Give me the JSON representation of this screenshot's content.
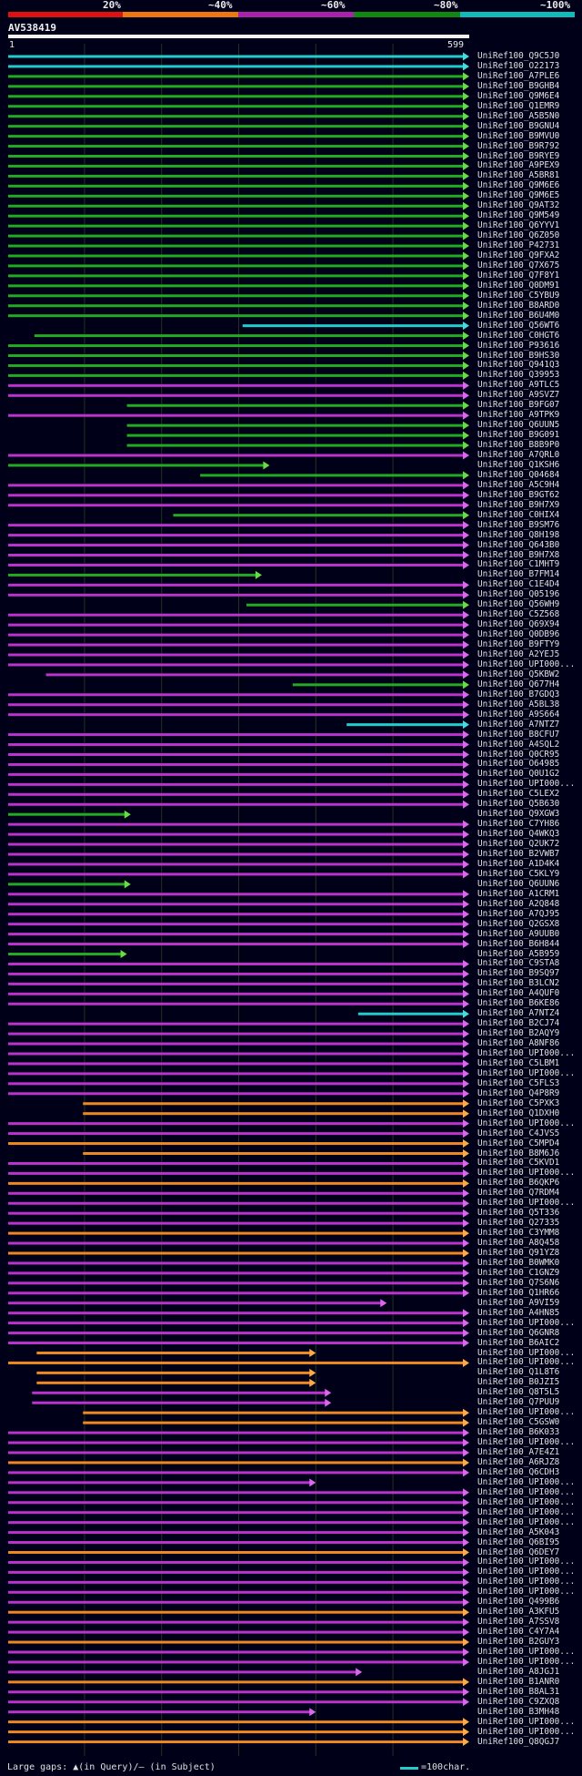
{
  "legend": {
    "labels": [
      "20%",
      "~40%",
      "~60%",
      "~80%",
      "~100%"
    ],
    "colors": [
      "#dd1111",
      "#ee7711",
      "#aa22aa",
      "#118811",
      "#11bbbb"
    ]
  },
  "query": {
    "name": "AV538419",
    "start": "1",
    "end": "599"
  },
  "footer": {
    "gaps_text": "Large gaps: ▲(in Query)/– (in Subject)",
    "scale_text": "=100char."
  },
  "chart_data": {
    "type": "alignment-overview",
    "query_length": 599,
    "color_by_identity": {
      "20%": "#dd1111",
      "~40%": "#ee7711",
      "~60%": "#aa22aa",
      "~80%": "#118811",
      "~100%": "#11bbbb"
    },
    "hits": [
      {
        "name": "UniRef100_Q9C5J0",
        "c": "t",
        "s": 1,
        "e": 599
      },
      {
        "name": "UniRef100_O22173",
        "c": "t",
        "s": 1,
        "e": 599
      },
      {
        "name": "UniRef100_A7PLE6",
        "c": "g",
        "s": 1,
        "e": 599
      },
      {
        "name": "UniRef100_B9GHB4",
        "c": "g",
        "s": 1,
        "e": 599
      },
      {
        "name": "UniRef100_Q9M6E4",
        "c": "g",
        "s": 1,
        "e": 599
      },
      {
        "name": "UniRef100_Q1EMR9",
        "c": "g",
        "s": 1,
        "e": 599
      },
      {
        "name": "UniRef100_A5B5N0",
        "c": "g",
        "s": 1,
        "e": 599
      },
      {
        "name": "UniRef100_B9GNU4",
        "c": "g",
        "s": 1,
        "e": 599
      },
      {
        "name": "UniRef100_B9MVU0",
        "c": "g",
        "s": 1,
        "e": 599
      },
      {
        "name": "UniRef100_B9R792",
        "c": "g",
        "s": 1,
        "e": 599
      },
      {
        "name": "UniRef100_B9RYE9",
        "c": "g",
        "s": 1,
        "e": 599
      },
      {
        "name": "UniRef100_A9PEX9",
        "c": "g",
        "s": 1,
        "e": 599
      },
      {
        "name": "UniRef100_A5BR81",
        "c": "g",
        "s": 1,
        "e": 599
      },
      {
        "name": "UniRef100_Q9M6E6",
        "c": "g",
        "s": 1,
        "e": 599
      },
      {
        "name": "UniRef100_Q9M6E5",
        "c": "g",
        "s": 1,
        "e": 599
      },
      {
        "name": "UniRef100_Q9AT32",
        "c": "g",
        "s": 1,
        "e": 599
      },
      {
        "name": "UniRef100_Q9M549",
        "c": "g",
        "s": 1,
        "e": 599
      },
      {
        "name": "UniRef100_Q6YYV1",
        "c": "g",
        "s": 1,
        "e": 599
      },
      {
        "name": "UniRef100_Q6Z050",
        "c": "g",
        "s": 1,
        "e": 599
      },
      {
        "name": "UniRef100_P42731",
        "c": "g",
        "s": 1,
        "e": 599
      },
      {
        "name": "UniRef100_Q9FXA2",
        "c": "g",
        "s": 1,
        "e": 599
      },
      {
        "name": "UniRef100_Q7X675",
        "c": "g",
        "s": 1,
        "e": 599
      },
      {
        "name": "UniRef100_Q7F8Y1",
        "c": "g",
        "s": 1,
        "e": 599
      },
      {
        "name": "UniRef100_Q0DM91",
        "c": "g",
        "s": 1,
        "e": 599
      },
      {
        "name": "UniRef100_C5YBU9",
        "c": "g",
        "s": 1,
        "e": 599
      },
      {
        "name": "UniRef100_B8ARD0",
        "c": "g",
        "s": 1,
        "e": 599
      },
      {
        "name": "UniRef100_B6U4M0",
        "c": "g",
        "s": 1,
        "e": 599
      },
      {
        "name": "UniRef100_Q56WT6",
        "c": "t",
        "s": 305,
        "e": 599
      },
      {
        "name": "UniRef100_C0HGT6",
        "c": "g",
        "s": 35,
        "e": 599
      },
      {
        "name": "UniRef100_P93616",
        "c": "g",
        "s": 1,
        "e": 599
      },
      {
        "name": "UniRef100_B9HS30",
        "c": "g",
        "s": 1,
        "e": 599
      },
      {
        "name": "UniRef100_Q941Q3",
        "c": "g",
        "s": 1,
        "e": 599
      },
      {
        "name": "UniRef100_Q39953",
        "c": "g",
        "s": 1,
        "e": 599
      },
      {
        "name": "UniRef100_A9TLC5",
        "c": "p",
        "s": 1,
        "e": 599
      },
      {
        "name": "UniRef100_A9SVZ7",
        "c": "p",
        "s": 1,
        "e": 599
      },
      {
        "name": "UniRef100_B9FG07",
        "c": "g",
        "s": 155,
        "e": 599
      },
      {
        "name": "UniRef100_A9TPK9",
        "c": "p",
        "s": 1,
        "e": 599
      },
      {
        "name": "UniRef100_Q6UUN5",
        "c": "g",
        "s": 155,
        "e": 599
      },
      {
        "name": "UniRef100_B9G091",
        "c": "g",
        "s": 155,
        "e": 599
      },
      {
        "name": "UniRef100_B8B9P0",
        "c": "g",
        "s": 155,
        "e": 599
      },
      {
        "name": "UniRef100_A7QRL0",
        "c": "p",
        "s": 1,
        "e": 599
      },
      {
        "name": "UniRef100_Q1KSH6",
        "c": "g",
        "s": 1,
        "e": 340
      },
      {
        "name": "UniRef100_Q04684",
        "c": "g",
        "s": 250,
        "e": 599
      },
      {
        "name": "UniRef100_A5C9H4",
        "c": "p",
        "s": 1,
        "e": 599
      },
      {
        "name": "UniRef100_B9GT62",
        "c": "p",
        "s": 1,
        "e": 599
      },
      {
        "name": "UniRef100_B9H7X9",
        "c": "p",
        "s": 1,
        "e": 599
      },
      {
        "name": "UniRef100_C0HIX4",
        "c": "g",
        "s": 215,
        "e": 599
      },
      {
        "name": "UniRef100_B9SM76",
        "c": "p",
        "s": 1,
        "e": 599
      },
      {
        "name": "UniRef100_Q8H198",
        "c": "p",
        "s": 1,
        "e": 599
      },
      {
        "name": "UniRef100_Q643B0",
        "c": "p",
        "s": 1,
        "e": 599
      },
      {
        "name": "UniRef100_B9H7X8",
        "c": "p",
        "s": 1,
        "e": 599
      },
      {
        "name": "UniRef100_C1MHT9",
        "c": "p",
        "s": 1,
        "e": 599
      },
      {
        "name": "UniRef100_B7FM14",
        "c": "g",
        "s": 1,
        "e": 330
      },
      {
        "name": "UniRef100_C1E4D4",
        "c": "p",
        "s": 1,
        "e": 599
      },
      {
        "name": "UniRef100_Q05196",
        "c": "p",
        "s": 1,
        "e": 599
      },
      {
        "name": "UniRef100_Q56WH9",
        "c": "g",
        "s": 310,
        "e": 599
      },
      {
        "name": "UniRef100_C5Z568",
        "c": "p",
        "s": 1,
        "e": 599
      },
      {
        "name": "UniRef100_Q69X94",
        "c": "p",
        "s": 1,
        "e": 599
      },
      {
        "name": "UniRef100_Q0DB96",
        "c": "p",
        "s": 1,
        "e": 599
      },
      {
        "name": "UniRef100_B9FTY9",
        "c": "p",
        "s": 1,
        "e": 599
      },
      {
        "name": "UniRef100_A2YEJ5",
        "c": "p",
        "s": 1,
        "e": 599
      },
      {
        "name": "UniRef100_UPI000...",
        "c": "p",
        "s": 1,
        "e": 599
      },
      {
        "name": "UniRef100_Q5KBW2",
        "c": "p",
        "s": 50,
        "e": 599
      },
      {
        "name": "UniRef100_Q677H4",
        "c": "g",
        "s": 370,
        "e": 599
      },
      {
        "name": "UniRef100_B7GDQ3",
        "c": "p",
        "s": 1,
        "e": 599
      },
      {
        "name": "UniRef100_A5BL38",
        "c": "p",
        "s": 1,
        "e": 599
      },
      {
        "name": "UniRef100_A9S664",
        "c": "p",
        "s": 1,
        "e": 599
      },
      {
        "name": "UniRef100_A7NTZ7",
        "c": "t",
        "s": 440,
        "e": 599
      },
      {
        "name": "UniRef100_B8CFU7",
        "c": "p",
        "s": 1,
        "e": 599
      },
      {
        "name": "UniRef100_A4SQL2",
        "c": "p",
        "s": 1,
        "e": 599
      },
      {
        "name": "UniRef100_Q0CR95",
        "c": "p",
        "s": 1,
        "e": 599
      },
      {
        "name": "UniRef100_O64985",
        "c": "p",
        "s": 1,
        "e": 599
      },
      {
        "name": "UniRef100_Q0U1G2",
        "c": "p",
        "s": 1,
        "e": 599
      },
      {
        "name": "UniRef100_UPI000...",
        "c": "p",
        "s": 1,
        "e": 599
      },
      {
        "name": "UniRef100_C5LEX2",
        "c": "p",
        "s": 1,
        "e": 599
      },
      {
        "name": "UniRef100_Q5B630",
        "c": "p",
        "s": 1,
        "e": 599
      },
      {
        "name": "UniRef100_Q9XGW3",
        "c": "g",
        "s": 1,
        "e": 160
      },
      {
        "name": "UniRef100_C7YH86",
        "c": "p",
        "s": 1,
        "e": 599
      },
      {
        "name": "UniRef100_Q4WKQ3",
        "c": "p",
        "s": 1,
        "e": 599
      },
      {
        "name": "UniRef100_Q2UK72",
        "c": "p",
        "s": 1,
        "e": 599
      },
      {
        "name": "UniRef100_B2VWB7",
        "c": "p",
        "s": 1,
        "e": 599
      },
      {
        "name": "UniRef100_A1D4K4",
        "c": "p",
        "s": 1,
        "e": 599
      },
      {
        "name": "UniRef100_C5KLY9",
        "c": "p",
        "s": 1,
        "e": 599
      },
      {
        "name": "UniRef100_Q6UUN6",
        "c": "g",
        "s": 1,
        "e": 160
      },
      {
        "name": "UniRef100_A1CRM1",
        "c": "p",
        "s": 1,
        "e": 599
      },
      {
        "name": "UniRef100_A2Q848",
        "c": "p",
        "s": 1,
        "e": 599
      },
      {
        "name": "UniRef100_A7QJ95",
        "c": "p",
        "s": 1,
        "e": 599
      },
      {
        "name": "UniRef100_Q2GSX8",
        "c": "p",
        "s": 1,
        "e": 599
      },
      {
        "name": "UniRef100_A9UUB0",
        "c": "p",
        "s": 1,
        "e": 599
      },
      {
        "name": "UniRef100_B6H844",
        "c": "p",
        "s": 1,
        "e": 599
      },
      {
        "name": "UniRef100_A5B959",
        "c": "g",
        "s": 1,
        "e": 155
      },
      {
        "name": "UniRef100_C9STA8",
        "c": "p",
        "s": 1,
        "e": 599
      },
      {
        "name": "UniRef100_B9SQ97",
        "c": "p",
        "s": 1,
        "e": 599
      },
      {
        "name": "UniRef100_B3LCN2",
        "c": "p",
        "s": 1,
        "e": 599
      },
      {
        "name": "UniRef100_A4QUF0",
        "c": "p",
        "s": 1,
        "e": 599
      },
      {
        "name": "UniRef100_B6KE86",
        "c": "p",
        "s": 1,
        "e": 599
      },
      {
        "name": "UniRef100_A7NTZ4",
        "c": "t",
        "s": 455,
        "e": 599
      },
      {
        "name": "UniRef100_B2CJ74",
        "c": "p",
        "s": 1,
        "e": 599
      },
      {
        "name": "UniRef100_B2AQY9",
        "c": "p",
        "s": 1,
        "e": 599
      },
      {
        "name": "UniRef100_A8NF86",
        "c": "p",
        "s": 1,
        "e": 599
      },
      {
        "name": "UniRef100_UPI000...",
        "c": "p",
        "s": 1,
        "e": 599
      },
      {
        "name": "UniRef100_C5LBM1",
        "c": "p",
        "s": 1,
        "e": 599
      },
      {
        "name": "UniRef100_UPI000...",
        "c": "p",
        "s": 1,
        "e": 599
      },
      {
        "name": "UniRef100_C5FLS3",
        "c": "p",
        "s": 1,
        "e": 599
      },
      {
        "name": "UniRef100_Q4P8R9",
        "c": "p",
        "s": 1,
        "e": 599
      },
      {
        "name": "UniRef100_C5PXK3",
        "c": "o",
        "s": 98,
        "e": 599
      },
      {
        "name": "UniRef100_Q1DXH0",
        "c": "o",
        "s": 98,
        "e": 599
      },
      {
        "name": "UniRef100_UPI000...",
        "c": "p",
        "s": 1,
        "e": 599
      },
      {
        "name": "UniRef100_C4JVS5",
        "c": "p",
        "s": 1,
        "e": 599
      },
      {
        "name": "UniRef100_C5MPD4",
        "c": "o",
        "s": 1,
        "e": 599
      },
      {
        "name": "UniRef100_B8M6J6",
        "c": "o",
        "s": 98,
        "e": 599
      },
      {
        "name": "UniRef100_C5KVD1",
        "c": "p",
        "s": 1,
        "e": 599
      },
      {
        "name": "UniRef100_UPI000...",
        "c": "p",
        "s": 1,
        "e": 599
      },
      {
        "name": "UniRef100_B6QKP6",
        "c": "o",
        "s": 1,
        "e": 599
      },
      {
        "name": "UniRef100_Q7RDM4",
        "c": "p",
        "s": 1,
        "e": 599
      },
      {
        "name": "UniRef100_UPI000...",
        "c": "p",
        "s": 1,
        "e": 599
      },
      {
        "name": "UniRef100_Q5T336",
        "c": "p",
        "s": 1,
        "e": 599
      },
      {
        "name": "UniRef100_Q27335",
        "c": "p",
        "s": 1,
        "e": 599
      },
      {
        "name": "UniRef100_C3YMM8",
        "c": "o",
        "s": 1,
        "e": 599
      },
      {
        "name": "UniRef100_A8Q458",
        "c": "p",
        "s": 1,
        "e": 599
      },
      {
        "name": "UniRef100_Q91YZ8",
        "c": "o",
        "s": 1,
        "e": 599
      },
      {
        "name": "UniRef100_B0WMK0",
        "c": "p",
        "s": 1,
        "e": 599
      },
      {
        "name": "UniRef100_C1GNZ9",
        "c": "p",
        "s": 1,
        "e": 599
      },
      {
        "name": "UniRef100_Q7S6N6",
        "c": "p",
        "s": 1,
        "e": 599
      },
      {
        "name": "UniRef100_Q1HR66",
        "c": "p",
        "s": 1,
        "e": 599
      },
      {
        "name": "UniRef100_A9VI59",
        "c": "p",
        "s": 1,
        "e": 492
      },
      {
        "name": "UniRef100_A4HN85",
        "c": "p",
        "s": 1,
        "e": 599
      },
      {
        "name": "UniRef100_UPI000...",
        "c": "p",
        "s": 1,
        "e": 599
      },
      {
        "name": "UniRef100_Q6GNR8",
        "c": "p",
        "s": 1,
        "e": 599
      },
      {
        "name": "UniRef100_B6AIC2",
        "c": "p",
        "s": 1,
        "e": 599
      },
      {
        "name": "UniRef100_UPI000...",
        "c": "o",
        "s": 38,
        "e": 400
      },
      {
        "name": "UniRef100_UPI000...",
        "c": "o",
        "s": 1,
        "e": 599
      },
      {
        "name": "UniRef100_Q1L8T6",
        "c": "o",
        "s": 38,
        "e": 400
      },
      {
        "name": "UniRef100_B0JZI5",
        "c": "o",
        "s": 38,
        "e": 400
      },
      {
        "name": "UniRef100_Q8T5L5",
        "c": "p",
        "s": 32,
        "e": 420
      },
      {
        "name": "UniRef100_Q7PUU9",
        "c": "p",
        "s": 32,
        "e": 420
      },
      {
        "name": "UniRef100_UPI000...",
        "c": "o",
        "s": 98,
        "e": 599
      },
      {
        "name": "UniRef100_C5GSW0",
        "c": "o",
        "s": 98,
        "e": 599
      },
      {
        "name": "UniRef100_B6K033",
        "c": "p",
        "s": 1,
        "e": 599
      },
      {
        "name": "UniRef100_UPI000...",
        "c": "p",
        "s": 1,
        "e": 599
      },
      {
        "name": "UniRef100_A7E4Z1",
        "c": "p",
        "s": 1,
        "e": 599
      },
      {
        "name": "UniRef100_A6RJZ8",
        "c": "o",
        "s": 1,
        "e": 599
      },
      {
        "name": "UniRef100_Q6CDH3",
        "c": "p",
        "s": 1,
        "e": 599
      },
      {
        "name": "UniRef100_UPI000...",
        "c": "p",
        "s": 1,
        "e": 400
      },
      {
        "name": "UniRef100_UPI000...",
        "c": "p",
        "s": 1,
        "e": 599
      },
      {
        "name": "UniRef100_UPI000...",
        "c": "p",
        "s": 1,
        "e": 599
      },
      {
        "name": "UniRef100_UPI000...",
        "c": "p",
        "s": 1,
        "e": 599
      },
      {
        "name": "UniRef100_UPI000...",
        "c": "p",
        "s": 1,
        "e": 599
      },
      {
        "name": "UniRef100_A5K043",
        "c": "p",
        "s": 1,
        "e": 599
      },
      {
        "name": "UniRef100_Q6BI95",
        "c": "p",
        "s": 1,
        "e": 599
      },
      {
        "name": "UniRef100_Q6DEY7",
        "c": "o",
        "s": 1,
        "e": 599
      },
      {
        "name": "UniRef100_UPI000...",
        "c": "p",
        "s": 1,
        "e": 599
      },
      {
        "name": "UniRef100_UPI000...",
        "c": "p",
        "s": 1,
        "e": 599
      },
      {
        "name": "UniRef100_UPI000...",
        "c": "p",
        "s": 1,
        "e": 599
      },
      {
        "name": "UniRef100_UPI000...",
        "c": "p",
        "s": 1,
        "e": 599
      },
      {
        "name": "UniRef100_Q499B6",
        "c": "p",
        "s": 1,
        "e": 599
      },
      {
        "name": "UniRef100_A3KFU5",
        "c": "o",
        "s": 1,
        "e": 599
      },
      {
        "name": "UniRef100_A7SSV8",
        "c": "p",
        "s": 1,
        "e": 599
      },
      {
        "name": "UniRef100_C4Y7A4",
        "c": "p",
        "s": 1,
        "e": 599
      },
      {
        "name": "UniRef100_B2GUY3",
        "c": "o",
        "s": 1,
        "e": 599
      },
      {
        "name": "UniRef100_UPI000...",
        "c": "p",
        "s": 1,
        "e": 599
      },
      {
        "name": "UniRef100_UPI000...",
        "c": "p",
        "s": 1,
        "e": 599
      },
      {
        "name": "UniRef100_A8JGJ1",
        "c": "p",
        "s": 1,
        "e": 460
      },
      {
        "name": "UniRef100_B1ANR0",
        "c": "o",
        "s": 1,
        "e": 599
      },
      {
        "name": "UniRef100_B8AL31",
        "c": "p",
        "s": 1,
        "e": 599
      },
      {
        "name": "UniRef100_C9ZXQ8",
        "c": "p",
        "s": 1,
        "e": 599
      },
      {
        "name": "UniRef100_B3MH48",
        "c": "p",
        "s": 1,
        "e": 400
      },
      {
        "name": "UniRef100_UPI000...",
        "c": "o",
        "s": 1,
        "e": 599
      },
      {
        "name": "UniRef100_UPI000...",
        "c": "o",
        "s": 1,
        "e": 599
      },
      {
        "name": "UniRef100_Q8QGJ7",
        "c": "o",
        "s": 1,
        "e": 599
      }
    ]
  }
}
